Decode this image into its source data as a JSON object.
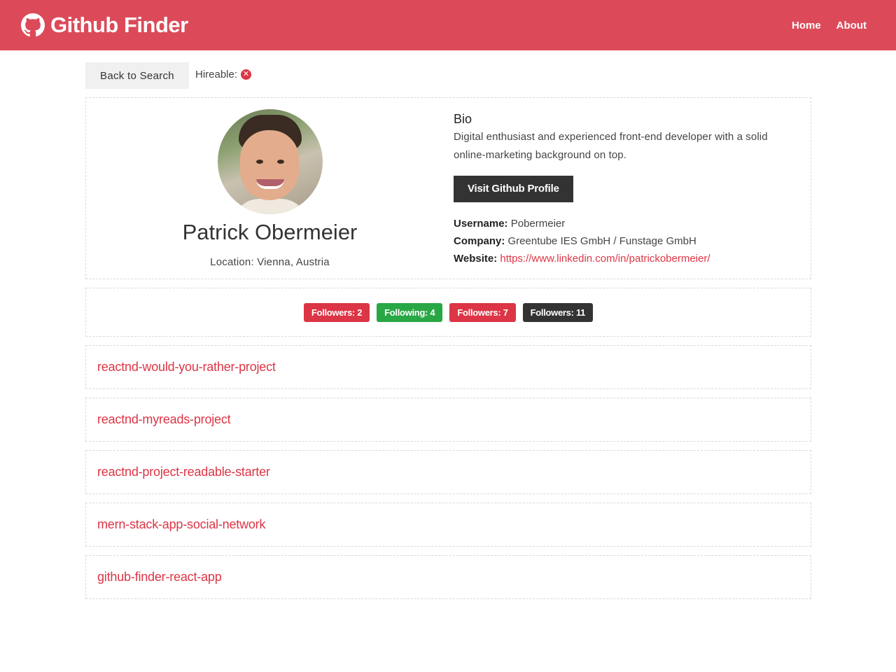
{
  "navbar": {
    "brand": "Github Finder",
    "links": [
      {
        "label": "Home"
      },
      {
        "label": "About"
      }
    ]
  },
  "topbar": {
    "back_label": "Back to Search",
    "hireable_label": "Hireable:",
    "hireable_icon": "times-circle-icon",
    "hireable_color": "#dc3545"
  },
  "profile": {
    "name": "Patrick Obermeier",
    "location": "Location: Vienna, Austria",
    "bio_title": "Bio",
    "bio": "Digital enthusiast and experienced front-end developer with a solid online-marketing background on top.",
    "visit_button": "Visit Github Profile",
    "username_label": "Username:",
    "username": "Pobermeier",
    "company_label": "Company:",
    "company": "Greentube IES GmbH / Funstage GmbH",
    "website_label": "Website:",
    "website": "https://www.linkedin.com/in/patrickobermeier/"
  },
  "badges": [
    {
      "label": "Followers: 2",
      "color": "#dc3545"
    },
    {
      "label": "Following: 4",
      "color": "#28a745"
    },
    {
      "label": "Followers: 7",
      "color": "#dc3545"
    },
    {
      "label": "Followers: 11",
      "color": "#333333"
    }
  ],
  "repos": [
    {
      "name": "reactnd-would-you-rather-project"
    },
    {
      "name": "reactnd-myreads-project"
    },
    {
      "name": "reactnd-project-readable-starter"
    },
    {
      "name": "mern-stack-app-social-network"
    },
    {
      "name": "github-finder-react-app"
    }
  ],
  "colors": {
    "navbar": "#dc4a59",
    "accent": "#dc3545",
    "dark": "#333333"
  }
}
